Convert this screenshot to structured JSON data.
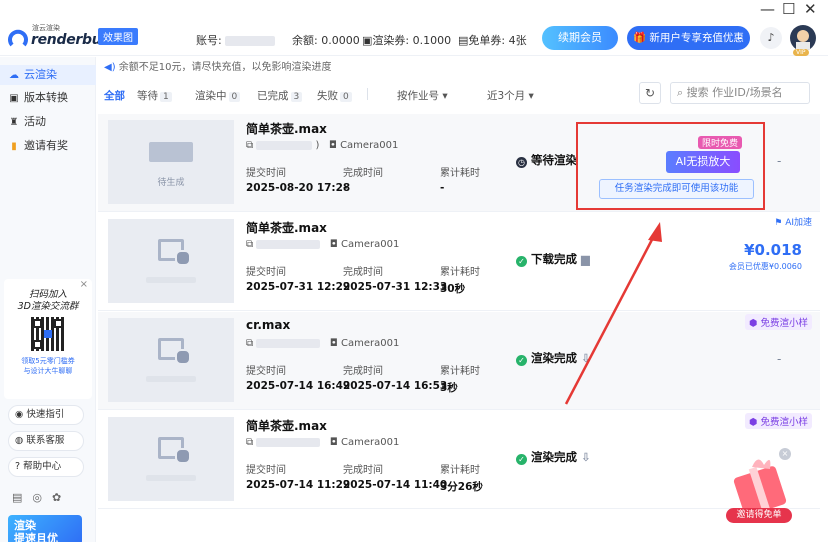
{
  "window": {
    "minimize": "—",
    "maximize": "☐",
    "close": "✕"
  },
  "header": {
    "logo_small": "渲云渲染",
    "logo_text": "renderbus",
    "plan_badge": "效果图",
    "account_label": "账号:",
    "balance_label": "余额: 0.0000",
    "coupon_label": "渲染券: 0.1000",
    "free_ticket_label": "免单券: 4张",
    "renew_button": "续期会员",
    "newuser_button": "新用户专享充值优惠",
    "vip_badge": "VIP"
  },
  "sidebar": {
    "items": [
      {
        "label": "云渲染",
        "icon": "cloud-icon"
      },
      {
        "label": "版本转换",
        "icon": "convert-icon"
      },
      {
        "label": "活动",
        "icon": "activity-icon"
      },
      {
        "label": "邀请有奖",
        "icon": "gift-icon"
      }
    ],
    "qr": {
      "title_line1": "扫码加入",
      "title_line2": "3D渲染交流群",
      "desc_line1": "领取5元零门槛券",
      "desc_line2": "与设计大牛聊聊",
      "close": "×"
    },
    "buttons": [
      {
        "label": "快速指引",
        "icon": "guide-icon"
      },
      {
        "label": "联系客服",
        "icon": "service-icon"
      },
      {
        "label": "帮助中心",
        "icon": "help-icon"
      }
    ],
    "promo_line1": "渲染",
    "promo_line2": "提速且优"
  },
  "notice": "余额不足10元，请尽快充值，以免影响渲染进度",
  "filters": {
    "all": "全部",
    "waiting": "等待",
    "waiting_count": "1",
    "rendering": "渲染中",
    "rendering_count": "0",
    "done": "已完成",
    "done_count": "3",
    "failed": "失败",
    "failed_count": "0",
    "sort": "按作业号",
    "range": "近3个月",
    "search_placeholder": "搜索 作业ID/场景名"
  },
  "labels": {
    "submit": "提交时间",
    "finish": "完成时间",
    "elapsed": "累计耗时"
  },
  "jobs": [
    {
      "name": "简单茶壶.max",
      "camera": "Camera001",
      "submit": "2025-08-20 17:28",
      "finish": "-",
      "elapsed": "-",
      "status": "等待渲染",
      "thumb_caption": "待生成",
      "right": "-"
    },
    {
      "name": "简单茶壶.max",
      "camera": "Camera001",
      "submit": "2025-07-31 12:29",
      "finish": "2025-07-31 12:33",
      "elapsed": "30秒",
      "status": "下载完成",
      "tag": "AI加速",
      "price": "¥0.018",
      "saved": "会员已优惠¥0.0060"
    },
    {
      "name": "cr.max",
      "camera": "Camera001",
      "submit": "2025-07-14 16:49",
      "finish": "2025-07-14 16:53",
      "elapsed": "3秒",
      "status": "渲染完成",
      "tag": "免费渲小样",
      "right": "-"
    },
    {
      "name": "简单茶壶.max",
      "camera": "Camera001",
      "submit": "2025-07-14 11:29",
      "finish": "2025-07-14 11:40",
      "elapsed": "3分26秒",
      "status": "渲染完成",
      "tag": "免费渲小样"
    }
  ],
  "ai_box": {
    "limited": "限时免费",
    "button": "AI无损放大",
    "tip": "任务渲染完成即可使用该功能"
  },
  "gift": {
    "label": "邀请得免单",
    "close": "×"
  }
}
